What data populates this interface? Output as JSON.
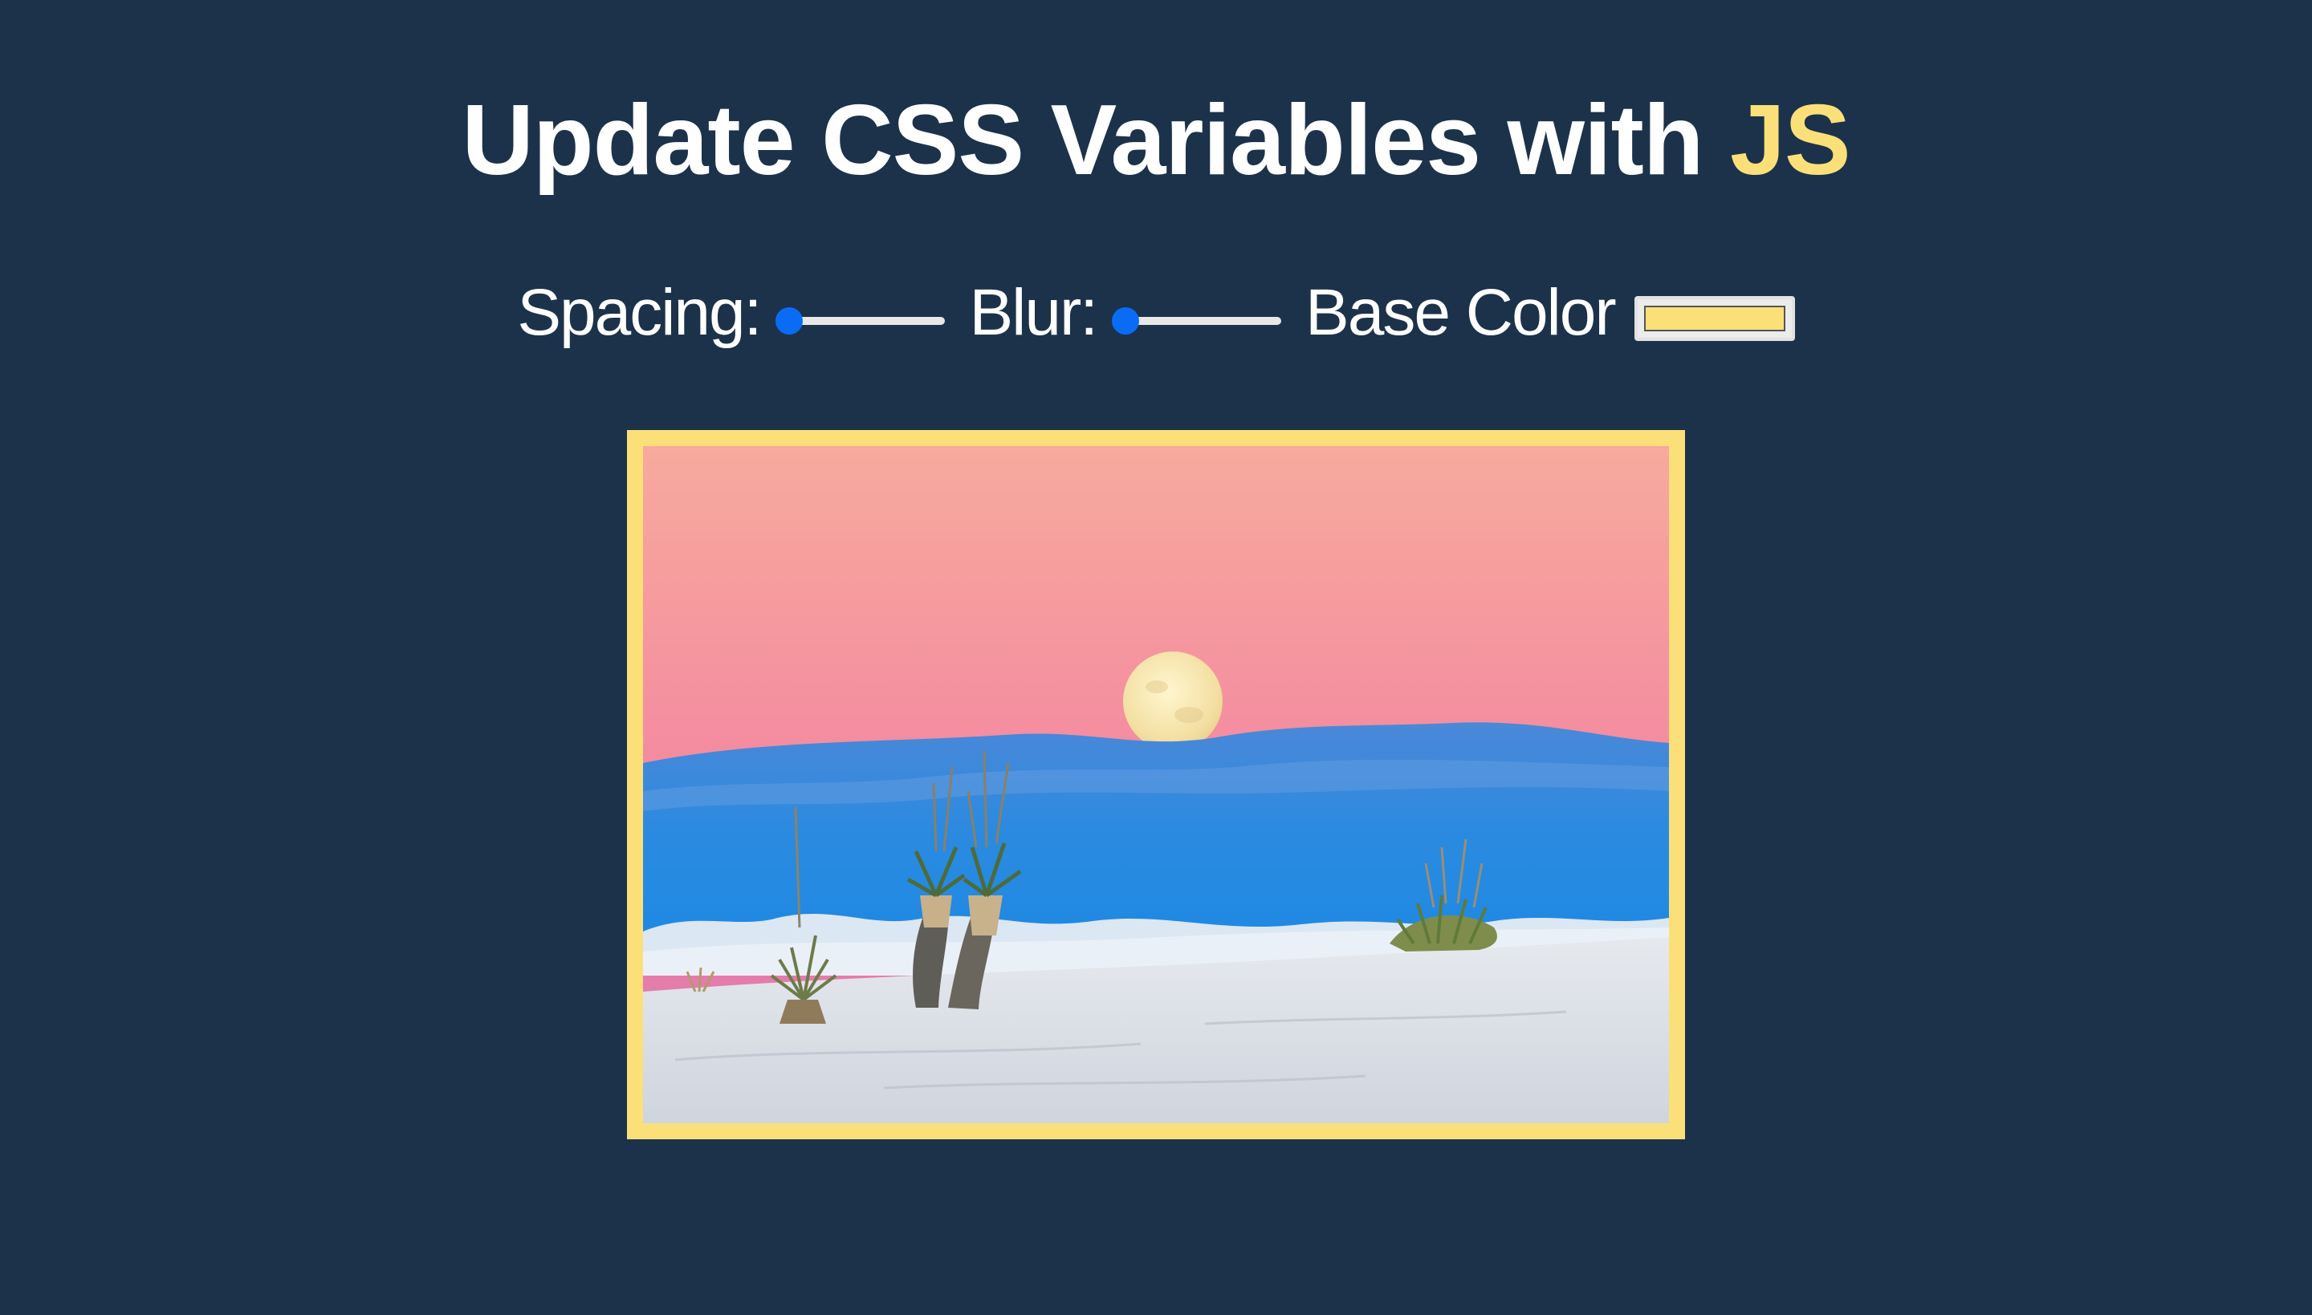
{
  "header": {
    "title_prefix": "Update CSS Variables with ",
    "title_highlight": "JS"
  },
  "controls": {
    "spacing": {
      "label": "Spacing:",
      "value": 0
    },
    "blur": {
      "label": "Blur:",
      "value": 0
    },
    "base_color": {
      "label": "Base Color",
      "value": "#fbe07a"
    }
  },
  "colors": {
    "background": "#1c324a",
    "accent": "#fbe07a",
    "slider_thumb": "#0a6cf5"
  },
  "photo": {
    "subject": "desert-sunset-moon-yucca"
  }
}
